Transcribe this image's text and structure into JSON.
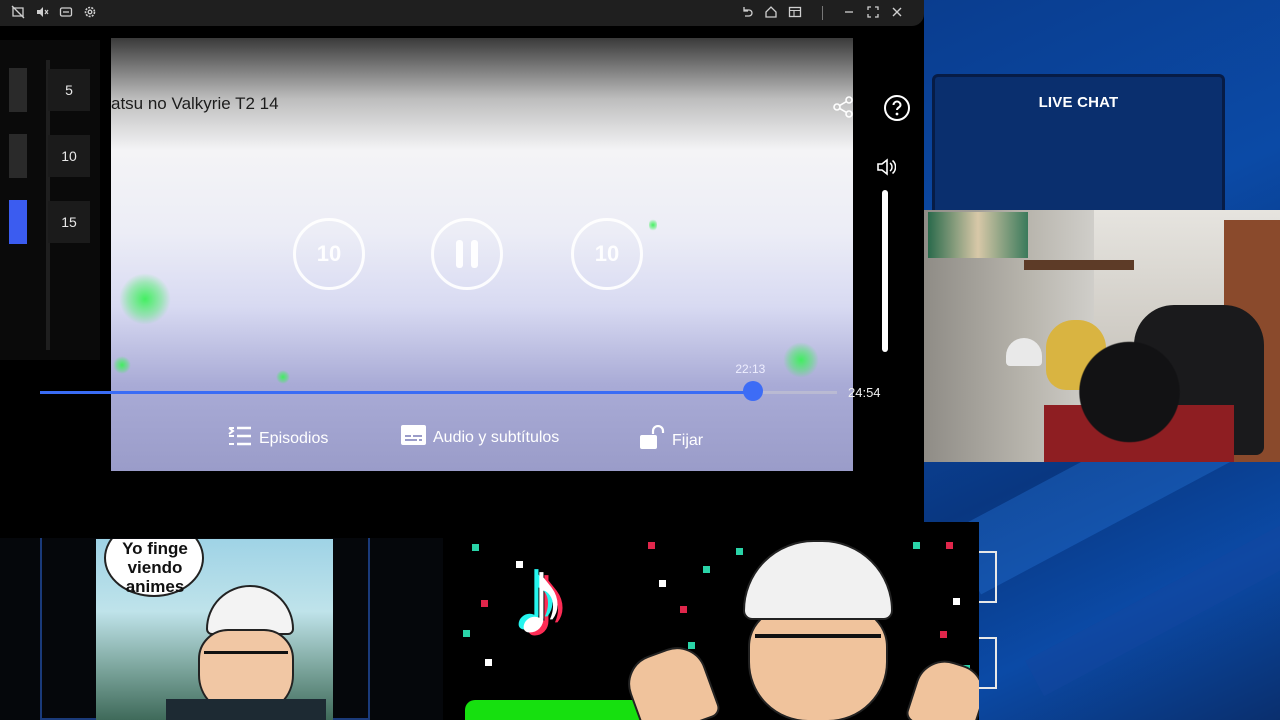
{
  "live_chat": {
    "title": "LIVE CHAT"
  },
  "player": {
    "title": "atsu no Valkyrie T2 14",
    "current_time": "22:13",
    "total_time": "24:54",
    "progress_fraction": 0.895,
    "skip_back_label": "10",
    "skip_forward_label": "10",
    "buttons": {
      "episodes": "Episodios",
      "audio_subtitles": "Audio y subtítulos",
      "lock": "Fijar"
    },
    "volume_level": 1.0
  },
  "side_panel": {
    "items": [
      {
        "label": "5"
      },
      {
        "label": "10"
      },
      {
        "label": "15",
        "active": true
      }
    ]
  },
  "overlay": {
    "comic_bubble": "Yo finge viendo animes"
  },
  "colors": {
    "accent_blue": "#3d6cf6",
    "chat_bg": "#0a2f6e",
    "tiktok_green": "#16e00f"
  }
}
